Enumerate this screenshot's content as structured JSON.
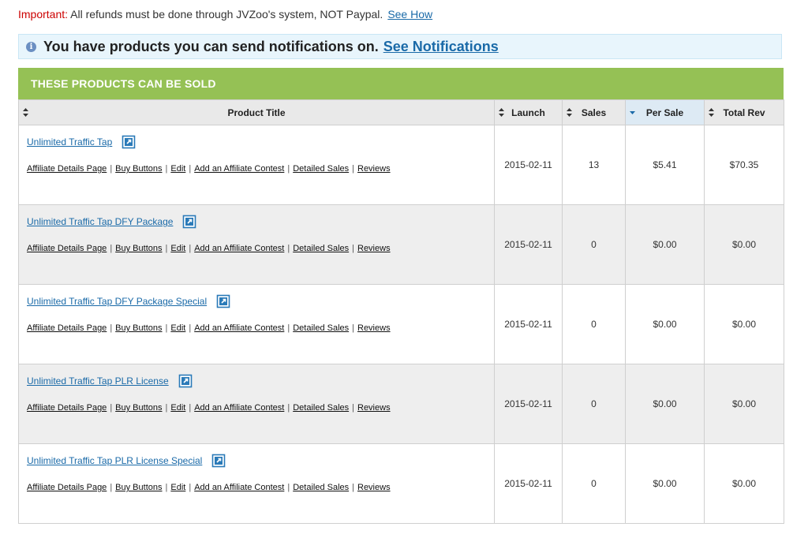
{
  "notice_important": {
    "label": "Important:",
    "text": " All refunds must be done through JVZoo's system, NOT Paypal.",
    "link": "See How"
  },
  "notification_bar": {
    "icon": "info-icon",
    "text": "You have products you can send notifications on.",
    "link": "See Notifications"
  },
  "products_section": {
    "title": "THESE PRODUCTS CAN BE SOLD"
  },
  "table": {
    "columns": [
      "Product Title",
      "Launch",
      "Sales",
      "Per Sale",
      "Total Rev"
    ],
    "sorted_column": "Per Sale",
    "action_links": [
      "Affiliate Details Page",
      "Buy Buttons",
      "Edit",
      "Add an Affiliate Contest",
      "Detailed Sales",
      "Reviews"
    ],
    "rows": [
      {
        "title": "Unlimited Traffic Tap",
        "launch": "2015-02-11",
        "sales": "13",
        "per_sale": "$5.41",
        "total_rev": "$70.35"
      },
      {
        "title": "Unlimited Traffic Tap DFY Package",
        "launch": "2015-02-11",
        "sales": "0",
        "per_sale": "$0.00",
        "total_rev": "$0.00"
      },
      {
        "title": "Unlimited Traffic Tap DFY Package Special",
        "launch": "2015-02-11",
        "sales": "0",
        "per_sale": "$0.00",
        "total_rev": "$0.00"
      },
      {
        "title": "Unlimited Traffic Tap PLR License",
        "launch": "2015-02-11",
        "sales": "0",
        "per_sale": "$0.00",
        "total_rev": "$0.00"
      },
      {
        "title": "Unlimited Traffic Tap PLR License Special",
        "launch": "2015-02-11",
        "sales": "0",
        "per_sale": "$0.00",
        "total_rev": "$0.00"
      }
    ]
  },
  "colors": {
    "important_red": "#cc0000",
    "link_blue": "#1a6aa8",
    "header_green": "#95c155",
    "notice_bg": "#e8f5fc"
  }
}
